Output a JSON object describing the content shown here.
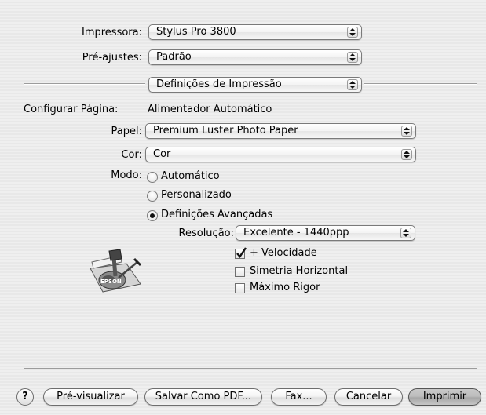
{
  "printer": {
    "label": "Impressora:",
    "value": "Stylus Pro 3800"
  },
  "presets": {
    "label": "Pré-ajustes:",
    "value": "Padrão"
  },
  "panel": {
    "value": "Definições de Impressão"
  },
  "page_setup": {
    "label": "Configurar Página:",
    "value": "Alimentador Automático"
  },
  "paper": {
    "label": "Papel:",
    "value": "Premium Luster Photo Paper"
  },
  "color": {
    "label": "Cor:",
    "value": "Cor"
  },
  "mode": {
    "label": "Modo:",
    "options": [
      "Automático",
      "Personalizado",
      "Definições Avançadas"
    ],
    "selected": "Definições Avançadas"
  },
  "resolution": {
    "label": "Resolução:",
    "value": "Excelente - 1440ppp"
  },
  "checkboxes": [
    {
      "label": "+ Velocidade",
      "checked": true
    },
    {
      "label": "Simetria Horizontal",
      "checked": false
    },
    {
      "label": "Máximo Rigor",
      "checked": false
    }
  ],
  "logo": {
    "text": "EPSON"
  },
  "buttons": {
    "help": "?",
    "preview": "Pré-visualizar",
    "save_pdf": "Salvar Como PDF...",
    "fax": "Fax...",
    "cancel": "Cancelar",
    "print": "Imprimir"
  }
}
